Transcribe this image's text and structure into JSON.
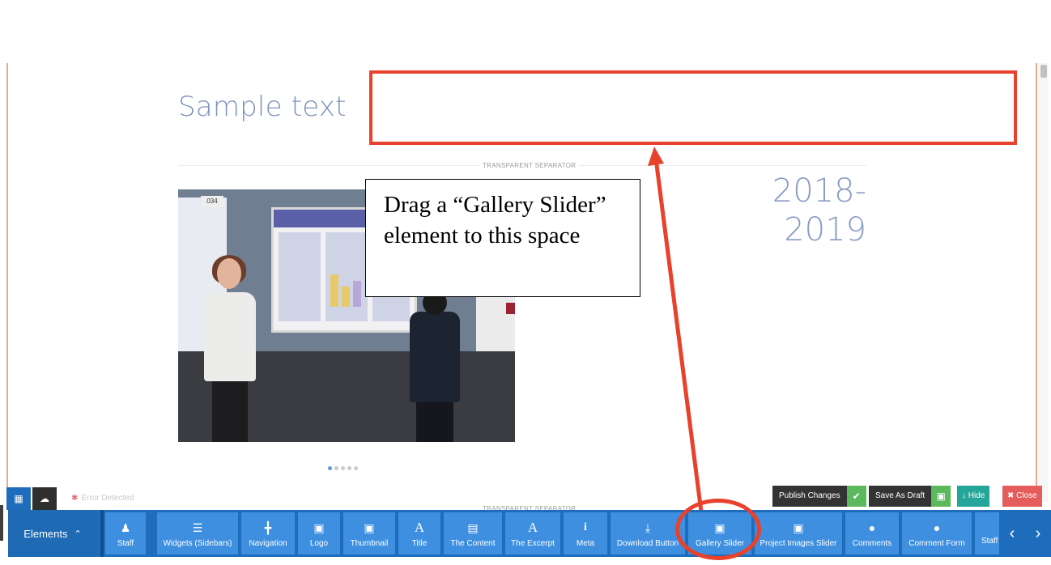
{
  "page": {
    "heading": "Sample text",
    "separator_top_label": "TRANSPARENT SEPARATOR",
    "separator_bottom_label": "TRANSPARENT SEPARATOR",
    "year_line1": "2018-",
    "year_line2": "2019",
    "photo_tag": "034"
  },
  "annotation": {
    "callout_text": "Drag a “Gallery Slider” element to this space"
  },
  "status": {
    "error_text": "Error Detected"
  },
  "actions": {
    "publish_label": "Publish Changes",
    "draft_label": "Save As Draft",
    "hide_label": "Hide",
    "close_label": "Close"
  },
  "toolbar": {
    "elements_label": "Elements",
    "tools": [
      {
        "label": "Staff",
        "icon": "user-icon"
      },
      {
        "label": "Widgets (Sidebars)",
        "icon": "widgets-icon"
      },
      {
        "label": "Navigation",
        "icon": "navigation-icon"
      },
      {
        "label": "Logo",
        "icon": "image-icon"
      },
      {
        "label": "Thumbnail",
        "icon": "image-icon"
      },
      {
        "label": "Title",
        "icon": "title-icon"
      },
      {
        "label": "The Content",
        "icon": "content-icon"
      },
      {
        "label": "The Excerpt",
        "icon": "title-icon"
      },
      {
        "label": "Meta",
        "icon": "info-icon"
      },
      {
        "label": "Download Button",
        "icon": "download-icon"
      },
      {
        "label": "Gallery Slider",
        "icon": "image-icon"
      },
      {
        "label": "Project Images Slider",
        "icon": "image-icon"
      },
      {
        "label": "Comments",
        "icon": "comments-icon"
      },
      {
        "label": "Comment Form",
        "icon": "comment-icon"
      },
      {
        "label": "Staff",
        "icon": "user-icon"
      }
    ]
  },
  "colors": {
    "accent_blue": "#3e8fe0",
    "bar_blue": "#1e6dbd",
    "annotation_red": "#e8412c",
    "publish_green": "#5cb85c",
    "hide_teal": "#26a69a",
    "close_red": "#e55c5c"
  }
}
